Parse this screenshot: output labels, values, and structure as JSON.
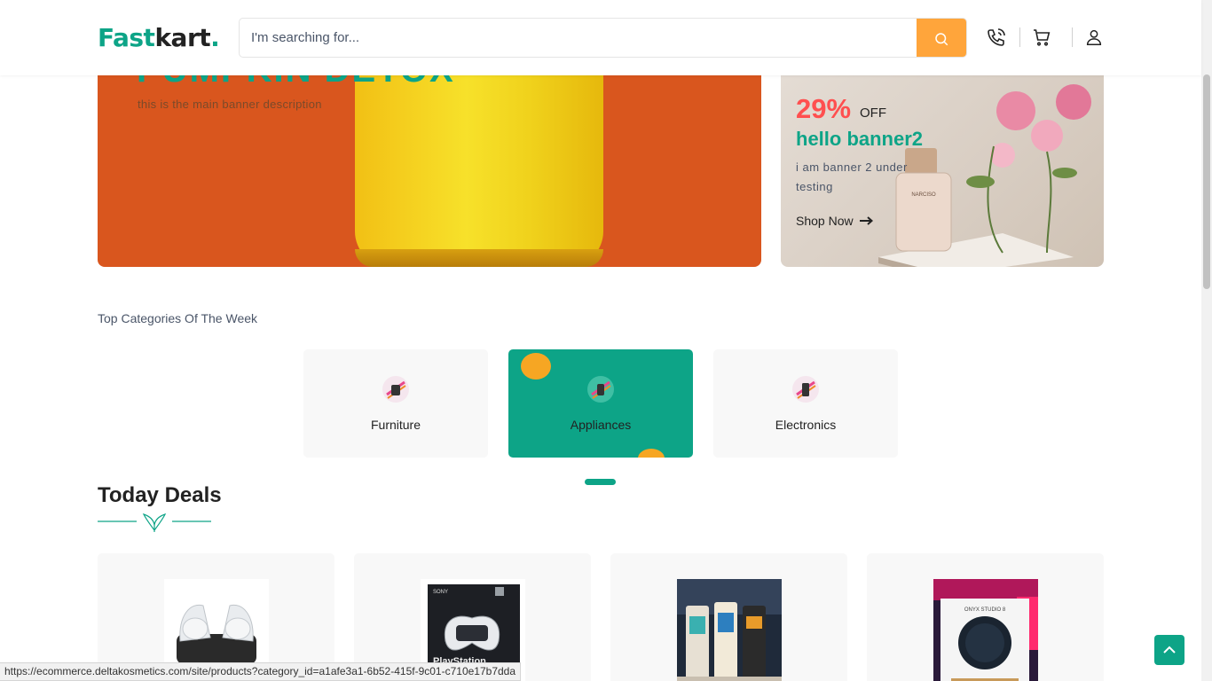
{
  "header": {
    "logo_prefix": "Fast",
    "logo_suffix": "kart",
    "logo_dot": ".",
    "search_placeholder": "I'm searching for...",
    "icons": [
      "search-icon",
      "phone-icon",
      "cart-icon",
      "user-icon"
    ]
  },
  "main_banner": {
    "title": "PUMPKIN DETOX",
    "description": "this is the main banner description"
  },
  "side_banner": {
    "discount": "29%",
    "off_label": "OFF",
    "title": "hello banner2",
    "description": "i am banner 2 under testing",
    "cta": "Shop Now",
    "product_label": "NARCISO"
  },
  "categories": {
    "heading": "Top Categories Of The Week",
    "items": [
      {
        "label": "Furniture",
        "active": false
      },
      {
        "label": "Appliances",
        "active": true
      },
      {
        "label": "Electronics",
        "active": false
      }
    ]
  },
  "deals": {
    "title": "Today Deals",
    "products": [
      {
        "image_label": "controller charging dock"
      },
      {
        "image_label": "PlayStation",
        "brand": "SONY"
      },
      {
        "image_label": "power banks"
      },
      {
        "image_label": "ONYX STUDIO 8"
      }
    ]
  },
  "status_bar": {
    "url": "https://ecommerce.deltakosmetics.com/site/products?category_id=a1afe3a1-6b52-415f-9c01-c710e17b7dda"
  },
  "colors": {
    "brand": "#0da487",
    "accent": "#ffa53b",
    "discount": "#ff4f4f"
  }
}
